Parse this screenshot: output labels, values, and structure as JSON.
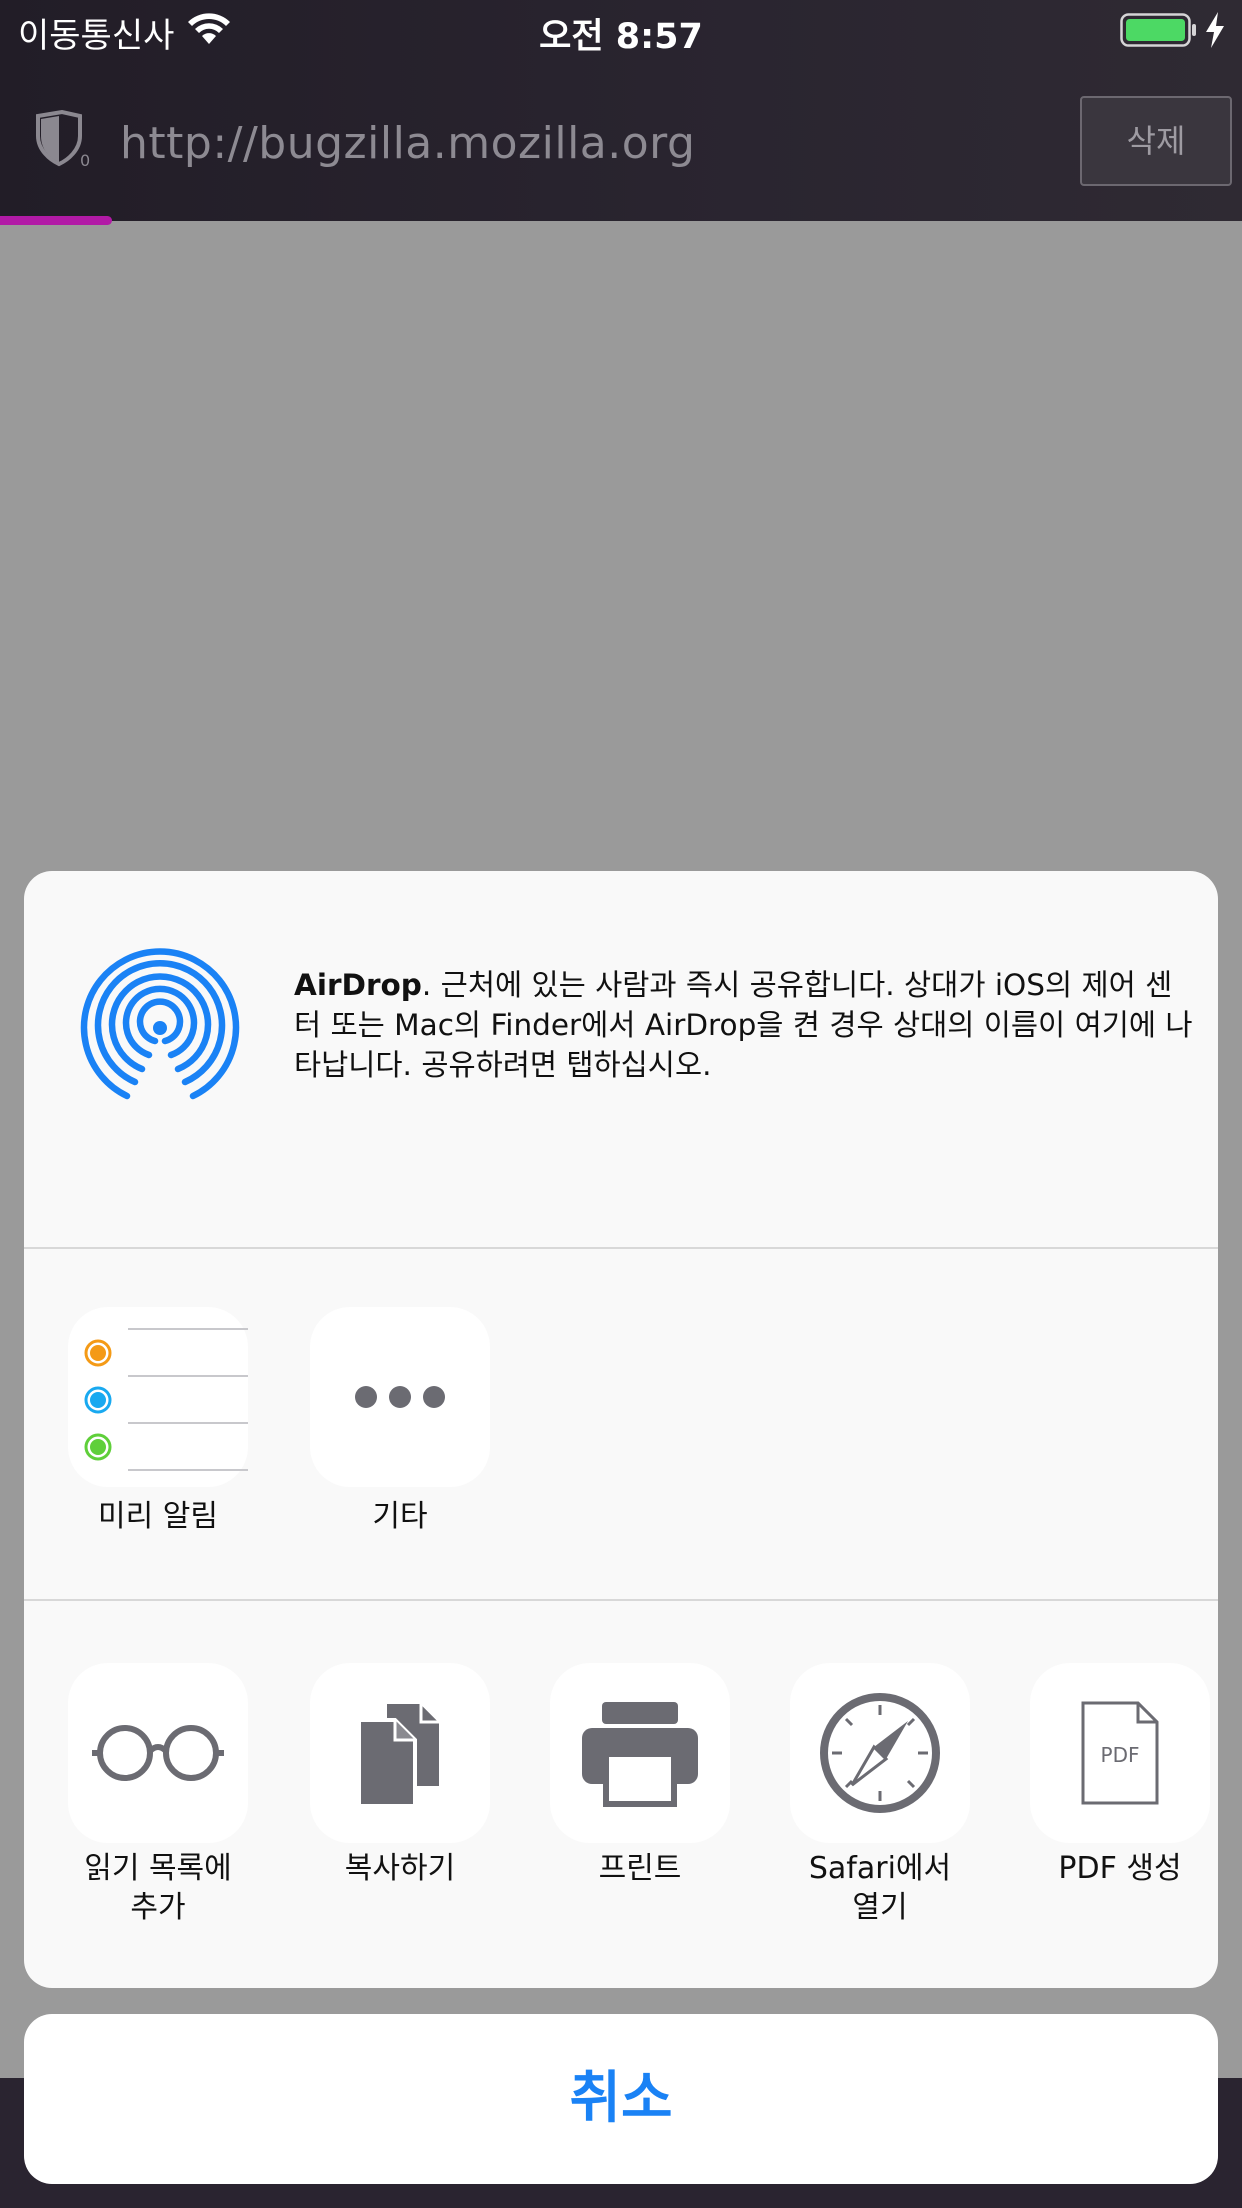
{
  "status_bar": {
    "carrier": "이동통신사",
    "time": "오전 8:57"
  },
  "url_bar": {
    "url": "http://bugzilla.mozilla.org",
    "delete_label": "삭제",
    "tracker_count": "0",
    "progress_fraction": 0.09
  },
  "share_sheet": {
    "airdrop": {
      "title": "AirDrop",
      "description": ". 근처에 있는 사람과 즉시 공유합니다. 상대가 iOS의 제어 센터 또는 Mac의 Finder에서 AirDrop을 켠 경우 상대의 이름이 여기에 나타납니다. 공유하려면 탭하십시오."
    },
    "apps": [
      {
        "label": "미리 알림",
        "icon": "reminders-icon"
      },
      {
        "label": "기타",
        "icon": "more-icon"
      }
    ],
    "actions": [
      {
        "label": "읽기 목록에\n추가",
        "icon": "glasses-icon"
      },
      {
        "label": "복사하기",
        "icon": "copy-icon"
      },
      {
        "label": "프린트",
        "icon": "printer-icon"
      },
      {
        "label": "Safari에서\n열기",
        "icon": "compass-icon"
      },
      {
        "label": "PDF 생성",
        "icon": "pdf-icon"
      }
    ],
    "pdf_icon_text": "PDF",
    "cancel_label": "취소"
  },
  "colors": {
    "accent": "#1a82f5",
    "progress": "#b21aa6",
    "toolbar": "#221d27"
  }
}
